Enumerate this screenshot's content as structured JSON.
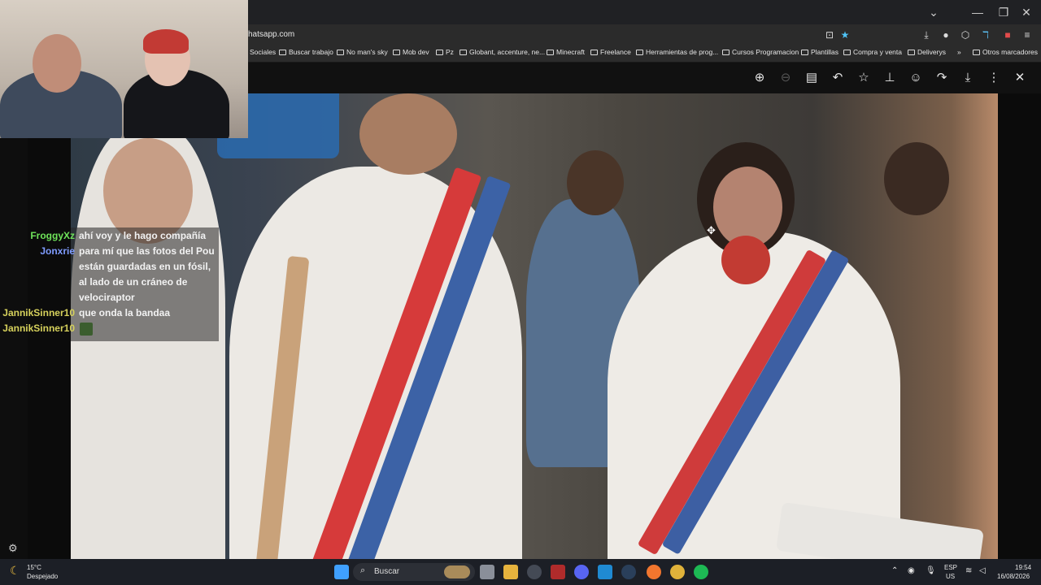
{
  "browser": {
    "url": "hatsapp.com",
    "bookmarks": [
      "Sociales",
      "Buscar trabajo",
      "No man's sky",
      "Mob dev",
      "Pz",
      "Globant, accenture, ne...",
      "Minecraft",
      "Freelance",
      "Herramientas de prog...",
      "Cursos Programacion",
      "Plantillas",
      "Compra y venta",
      "Deliverys"
    ],
    "more_bookmarks": "»",
    "other_bookmarks": "Otros marcadores"
  },
  "viewer": {
    "icons": [
      "zoom-in-icon",
      "zoom-out-icon",
      "caption-icon",
      "reply-icon",
      "star-icon",
      "pin-icon",
      "emoji-icon",
      "forward-icon",
      "download-icon",
      "more-icon",
      "close-icon"
    ]
  },
  "chat": {
    "messages": [
      {
        "nick": "FroggyXz",
        "color": "#6fe35a",
        "text": "ahí voy y le hago compañía"
      },
      {
        "nick": "Jonxrie",
        "color": "#7f9cff",
        "text": "para mí que las fotos del Pou están guardadas en un fósil, al lado de un cráneo de velociraptor"
      },
      {
        "nick": "JannikSinner10",
        "color": "#d6d15c",
        "text": "que onda la bandaa"
      },
      {
        "nick": "JannikSinner10",
        "color": "#d6d15c",
        "text": ""
      }
    ]
  },
  "taskbar": {
    "weather_temp": "15°C",
    "weather_desc": "Despejado",
    "search_placeholder": "Buscar",
    "lang": "ESP",
    "region": "US",
    "time": "19:54",
    "date": "16/08/2026"
  }
}
